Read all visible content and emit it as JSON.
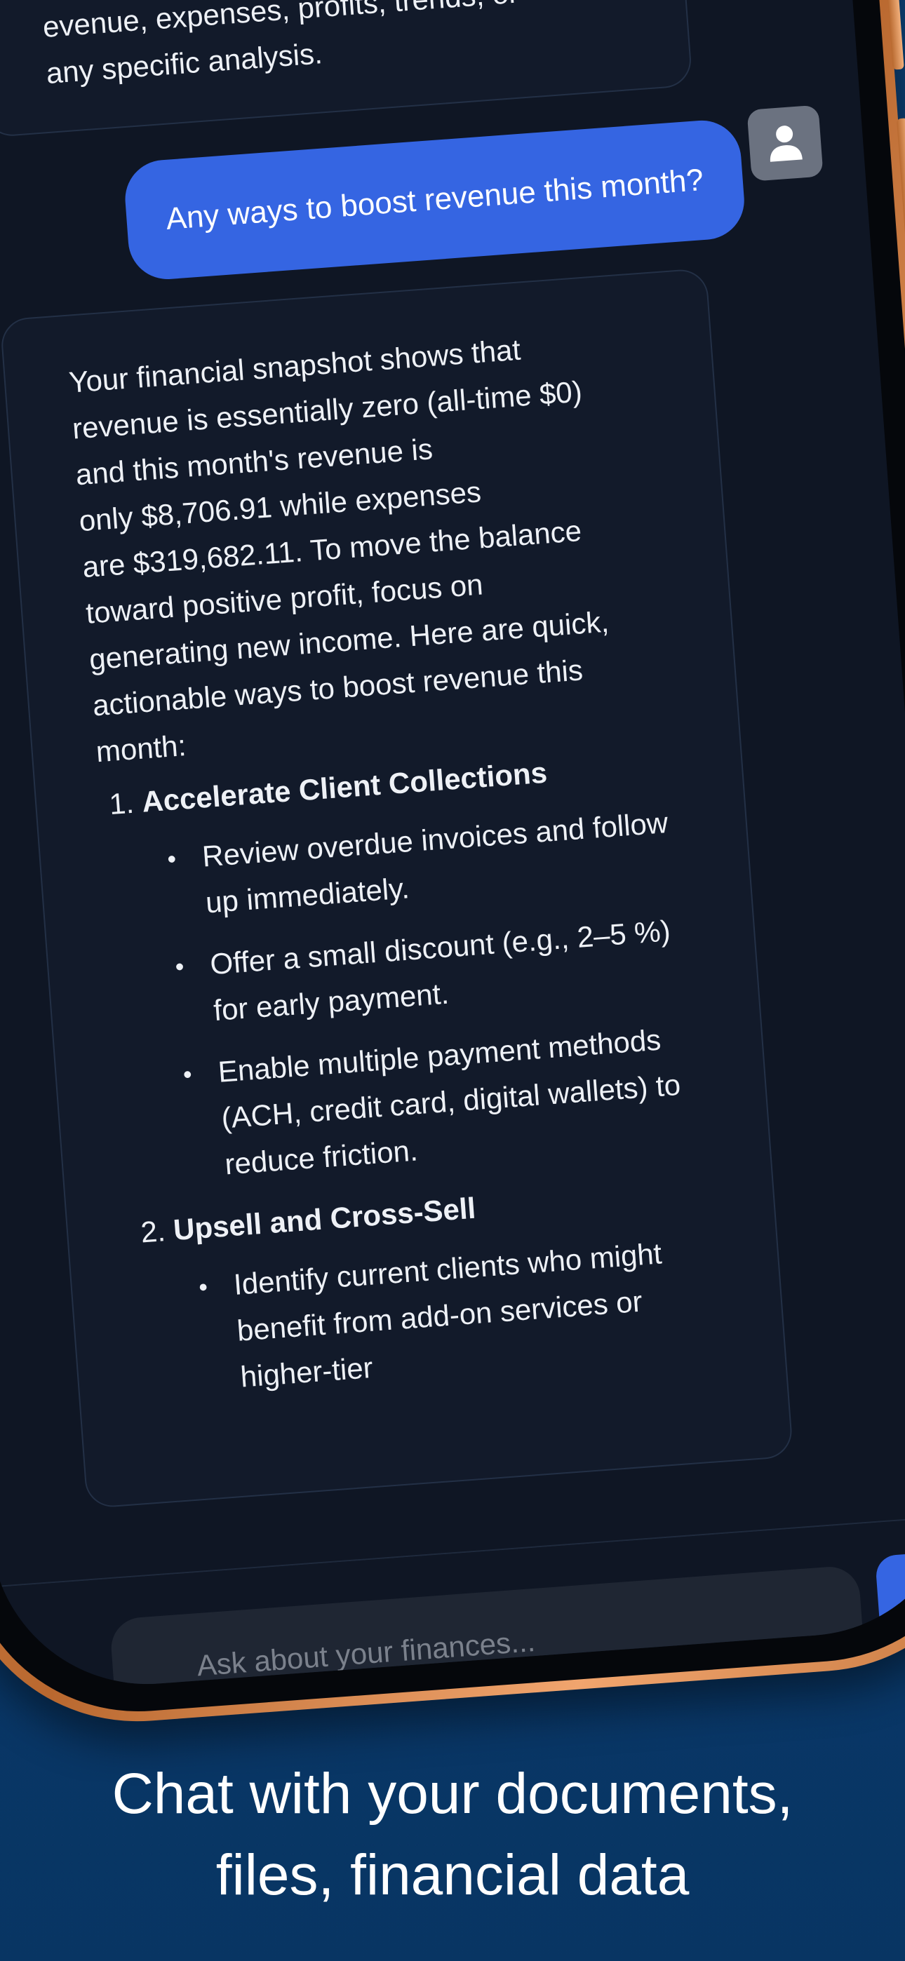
{
  "chat": {
    "previous_message": "evenue, expenses, profits, trends, or\nany specific analysis.",
    "user_message": "Any ways to boost revenue this month?",
    "assistant": {
      "intro": "Your financial snapshot shows that\nrevenue is essentially zero (all-time $0)\nand this month's revenue is\nonly $8,706.91 while expenses\nare $319,682.11. To move the balance\ntoward positive profit, focus on\ngenerating new income. Here are quick,\nactionable ways to boost revenue this\nmonth:",
      "steps": [
        {
          "title": "Accelerate Client Collections",
          "items": [
            "Review overdue invoices and follow up immediately.",
            "Offer a small discount (e.g., 2–5 %) for early payment.",
            "Enable multiple payment methods (ACH, credit card, digital wallets) to reduce friction."
          ]
        },
        {
          "title": "Upsell and Cross-Sell",
          "items": [
            "Identify current clients who might benefit from add-on services or higher-tier"
          ]
        }
      ]
    },
    "input_placeholder": "Ask about your finances..."
  },
  "icons": {
    "avatar": "user-icon",
    "send": "arrow-up-icon"
  },
  "colors": {
    "background": "#0b3a6d",
    "accent": "#3565e2",
    "screen": "#0f1624",
    "frame": "#d8894f"
  },
  "caption": {
    "line1": "Chat with your documents,",
    "line2": "files, financial data"
  }
}
